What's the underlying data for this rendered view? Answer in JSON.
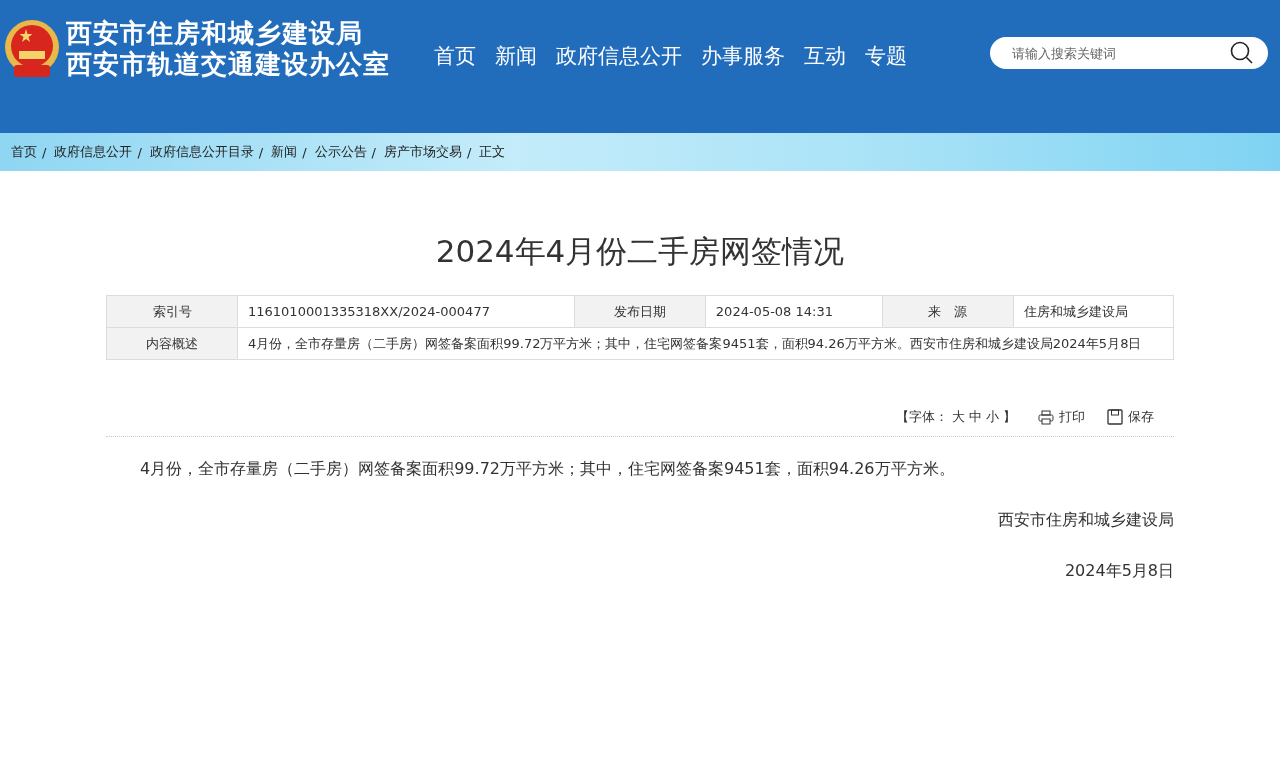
{
  "header": {
    "titles": [
      "西安市住房和城乡建设局",
      "西安市轨道交通建设办公室"
    ],
    "nav": [
      "首页",
      "新闻",
      "政府信息公开",
      "办事服务",
      "互动",
      "专题"
    ],
    "search": {
      "placeholder": "请输入搜索关键词"
    }
  },
  "breadcrumb": {
    "separator": "/",
    "items": [
      "首页",
      "政府信息公开",
      "政府信息公开目录",
      "新闻",
      "公示公告",
      "房产市场交易",
      "正文"
    ]
  },
  "article": {
    "title": "2024年4月份二手房网签情况",
    "meta": [
      [
        {
          "label": "索引号",
          "value": "1161010001335318XX/2024-000477"
        },
        {
          "label": "发布日期",
          "value": "2024-05-08 14:31"
        },
        {
          "label": "来　源",
          "value": "住房和城乡建设局"
        }
      ],
      [
        {
          "label": "内容概述",
          "value": "4月份，全市存量房（二手房）网签备案面积99.72万平方米；其中，住宅网签备案9451套，面积94.26万平方米。西安市住房和城乡建设局2024年5月8日"
        }
      ]
    ],
    "tools": {
      "font_prefix": "【字体：",
      "font_sizes": [
        "大",
        "中",
        "小"
      ],
      "font_suffix": "】",
      "print": "打印",
      "save": "保存"
    },
    "body": "4月份，全市存量房（二手房）网签备案面积99.72万平方米；其中，住宅网签备案9451套，面积94.26万平方米。",
    "signature": "西安市住房和城乡建设局",
    "date": "2024年5月8日"
  }
}
